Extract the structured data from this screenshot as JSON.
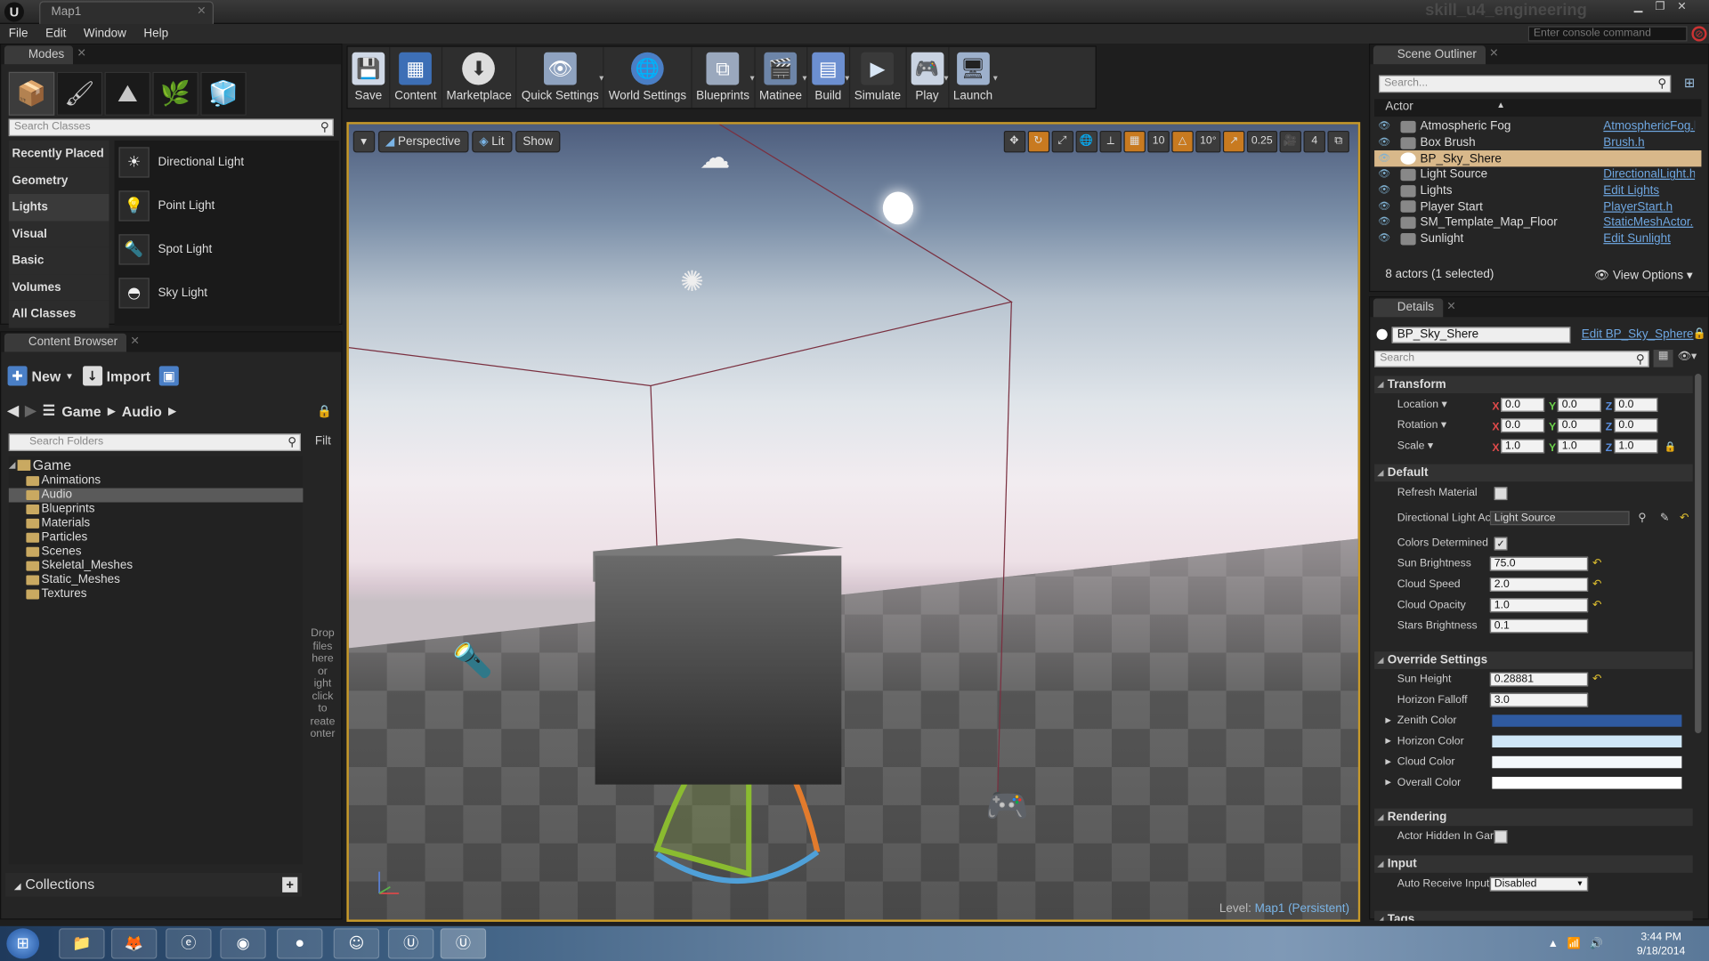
{
  "window": {
    "doc_tab": "Map1",
    "project": "skill_u4_engineering"
  },
  "menu": [
    "File",
    "Edit",
    "Window",
    "Help"
  ],
  "console": {
    "placeholder": "Enter console command"
  },
  "modes": {
    "tab": "Modes",
    "search_placeholder": "Search Classes",
    "categories": [
      "Recently Placed",
      "Geometry",
      "Lights",
      "Visual",
      "Basic",
      "Volumes",
      "All Classes"
    ],
    "items": [
      "Directional Light",
      "Point Light",
      "Spot Light",
      "Sky Light"
    ]
  },
  "content_browser": {
    "tab": "Content Browser",
    "new_label": "New",
    "import_label": "Import",
    "path": [
      "Game",
      "Audio"
    ],
    "search_placeholder": "Search Folders",
    "filter_label": "Filt",
    "root": "Game",
    "folders": [
      "Animations",
      "Audio",
      "Blueprints",
      "Materials",
      "Particles",
      "Scenes",
      "Skeletal_Meshes",
      "Static_Meshes",
      "Textures"
    ],
    "drop_hint": [
      "Drop",
      "files",
      "here",
      "or",
      "ight",
      "click",
      "to",
      "reate",
      "onter"
    ],
    "collections": "Collections"
  },
  "toolbar": {
    "buttons": [
      "Save",
      "Content",
      "Marketplace",
      "Quick Settings",
      "World Settings",
      "Blueprints",
      "Matinee",
      "Build",
      "Simulate",
      "Play",
      "Launch"
    ]
  },
  "viewport": {
    "perspective": "Perspective",
    "lit": "Lit",
    "show": "Show",
    "grid_snap": "10",
    "rot_snap": "10°",
    "scale_snap": "0.25",
    "cam_speed": "4",
    "level_prefix": "Level:",
    "level_name": "Map1 (Persistent)"
  },
  "outliner": {
    "tab": "Scene Outliner",
    "search_placeholder": "Search...",
    "column": "Actor",
    "rows": [
      {
        "name": "Atmospheric Fog",
        "type": "AtmosphericFog.l"
      },
      {
        "name": "Box Brush",
        "type": "Brush.h"
      },
      {
        "name": "BP_Sky_Shere",
        "type": ""
      },
      {
        "name": "Light Source",
        "type": "DirectionalLight.h"
      },
      {
        "name": "Lights",
        "type": "Edit Lights"
      },
      {
        "name": "Player Start",
        "type": "PlayerStart.h"
      },
      {
        "name": "SM_Template_Map_Floor",
        "type": "StaticMeshActor."
      },
      {
        "name": "Sunlight",
        "type": "Edit Sunlight"
      }
    ],
    "status": "8 actors (1 selected)",
    "view_options": "View Options"
  },
  "details": {
    "tab": "Details",
    "name": "BP_Sky_Shere",
    "edit_link": "Edit BP_Sky_Sphere",
    "search_placeholder": "Search",
    "transform": {
      "title": "Transform",
      "location_label": "Location",
      "rotation_label": "Rotation",
      "scale_label": "Scale",
      "location": [
        "0.0",
        "0.0",
        "0.0"
      ],
      "rotation": [
        "0.0",
        "0.0",
        "0.0"
      ],
      "scale": [
        "1.0",
        "1.0",
        "1.0"
      ]
    },
    "default": {
      "title": "Default",
      "refresh_material": "Refresh Material",
      "directional_light": "Directional Light Ac",
      "directional_light_value": "Light Source",
      "colors_determined": "Colors Determined",
      "sun_brightness": "Sun Brightness",
      "sun_brightness_value": "75.0",
      "cloud_speed": "Cloud Speed",
      "cloud_speed_value": "2.0",
      "cloud_opacity": "Cloud Opacity",
      "cloud_opacity_value": "1.0",
      "stars_brightness": "Stars Brightness",
      "stars_brightness_value": "0.1"
    },
    "override": {
      "title": "Override Settings",
      "sun_height": "Sun Height",
      "sun_height_value": "0.28881",
      "horizon_falloff": "Horizon Falloff",
      "horizon_falloff_value": "3.0",
      "zenith_color": "Zenith Color",
      "horizon_color": "Horizon Color",
      "cloud_color": "Cloud Color",
      "overall_color": "Overall Color",
      "colors": {
        "zenith": "#2f5aa0",
        "horizon": "#cfe7f7",
        "cloud": "#f4f8fb",
        "overall": "#ffffff"
      }
    },
    "rendering": {
      "title": "Rendering",
      "hidden": "Actor Hidden In Gar"
    },
    "input": {
      "title": "Input",
      "auto_receive": "Auto Receive Input",
      "auto_receive_value": "Disabled"
    },
    "tags": {
      "title": "Tags"
    }
  },
  "taskbar": {
    "time": "3:44 PM",
    "date": "9/18/2014"
  }
}
